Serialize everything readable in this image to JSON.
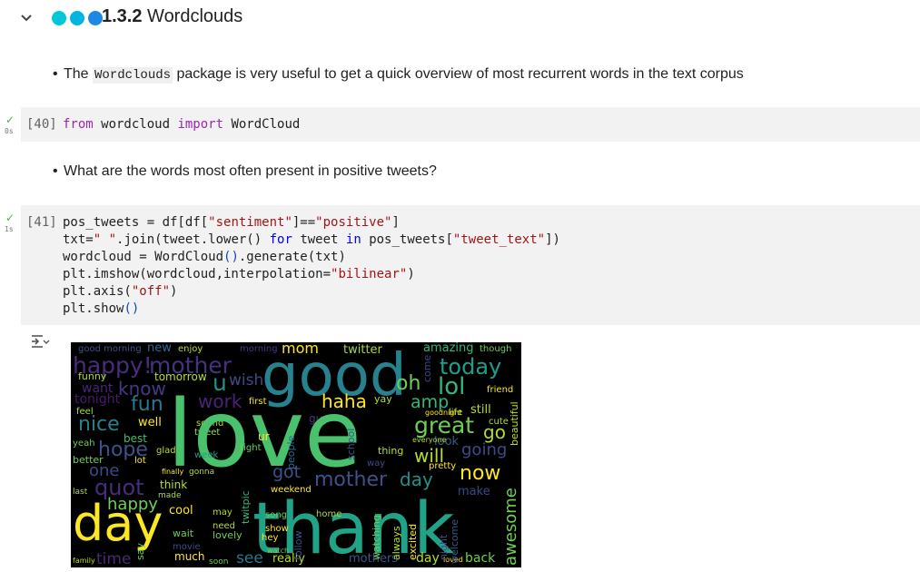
{
  "section": {
    "collapse_icon": "chevron-down-icon",
    "dots_colors": [
      "#00c8d4",
      "#00b5e0",
      "#1e88e5"
    ],
    "number": "1.3.2",
    "title": "Wordclouds"
  },
  "bullet1": {
    "prefix": "The ",
    "code": "Wordclouds",
    "suffix": " package is very useful to get a quick overview of most recurrent words in the text corpus"
  },
  "cell40": {
    "prompt": "[40]",
    "status": "✓",
    "time": "0s",
    "kw_from": "from",
    "module": " wordcloud ",
    "kw_import": "import",
    "name": " WordCloud"
  },
  "bullet2": {
    "text": "What are the words most often present in positive tweets?"
  },
  "cell41": {
    "prompt": "[41]",
    "status": "✓",
    "time": "1s"
  },
  "output": {
    "icon": "output-options-icon"
  },
  "wordcloud": {
    "words": [
      "love",
      "thank",
      "good",
      "day",
      "happy",
      "mother",
      "today",
      "nice",
      "great",
      "hope",
      "lol",
      "mom",
      "quot",
      "work",
      "fun",
      "haha",
      "going",
      "now",
      "one",
      "well",
      "got",
      "know",
      "want",
      "amp",
      "will",
      "time",
      "see",
      "back",
      "awesome",
      "tomorrow",
      "wish",
      "twitter",
      "new",
      "enjoy",
      "morning",
      "mothers",
      "really",
      "best",
      "still",
      "go",
      "today",
      "friend",
      "sleep",
      "think",
      "cool",
      "follow",
      "watching",
      "night",
      "excited",
      "welcome",
      "last",
      "make",
      "look",
      "everyone",
      "yeah",
      "better",
      "funny",
      "tonight",
      "feel",
      "right",
      "sound",
      "tweet",
      "school",
      "people",
      "thing",
      "way",
      "song",
      "home",
      "show",
      "lovely",
      "wait",
      "movie",
      "much",
      "soon",
      "family",
      "amazing",
      "though",
      "let",
      "getting",
      "sweet",
      "oh",
      "cute",
      "life",
      "goodnight",
      "beautiful",
      "guy",
      "ur",
      "first",
      "yay",
      "still",
      "glad",
      "lot",
      "finally",
      "gonna",
      "made",
      "weekend",
      "need",
      "hey",
      "watch",
      "always",
      "another",
      "live",
      "pretty",
      "ready",
      "hour",
      "week",
      "may",
      "say"
    ]
  }
}
